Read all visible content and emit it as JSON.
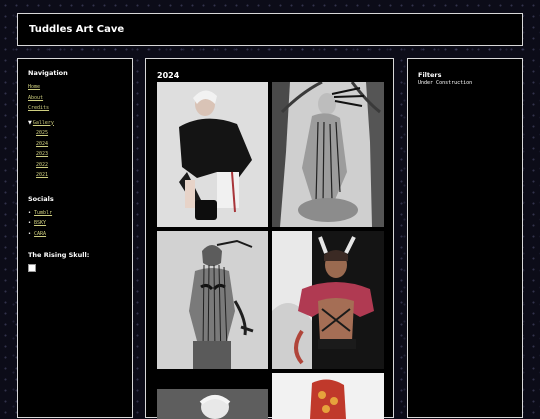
{
  "header": {
    "title": "Tuddles Art Cave"
  },
  "sidebar": {
    "nav_heading": "Navigation",
    "nav": [
      {
        "label": "Home"
      },
      {
        "label": "About"
      },
      {
        "label": "Credits"
      },
      {
        "label": "Gallery"
      }
    ],
    "gallery_years": [
      "2025",
      "2024",
      "2023",
      "2022",
      "2021"
    ],
    "socials_heading": "Socials",
    "socials": [
      {
        "label": "Tumblr"
      },
      {
        "label": "BSKY"
      },
      {
        "label": "CARA"
      }
    ],
    "rising_skull_heading": "The Rising Skull:"
  },
  "main": {
    "year_heading": "2024"
  },
  "right": {
    "filters_heading": "Filters",
    "filters_status": "Under Construction"
  },
  "colors": {
    "background": "#0c0c18",
    "border": "#d8d8d8",
    "link": "#cfcf80"
  }
}
